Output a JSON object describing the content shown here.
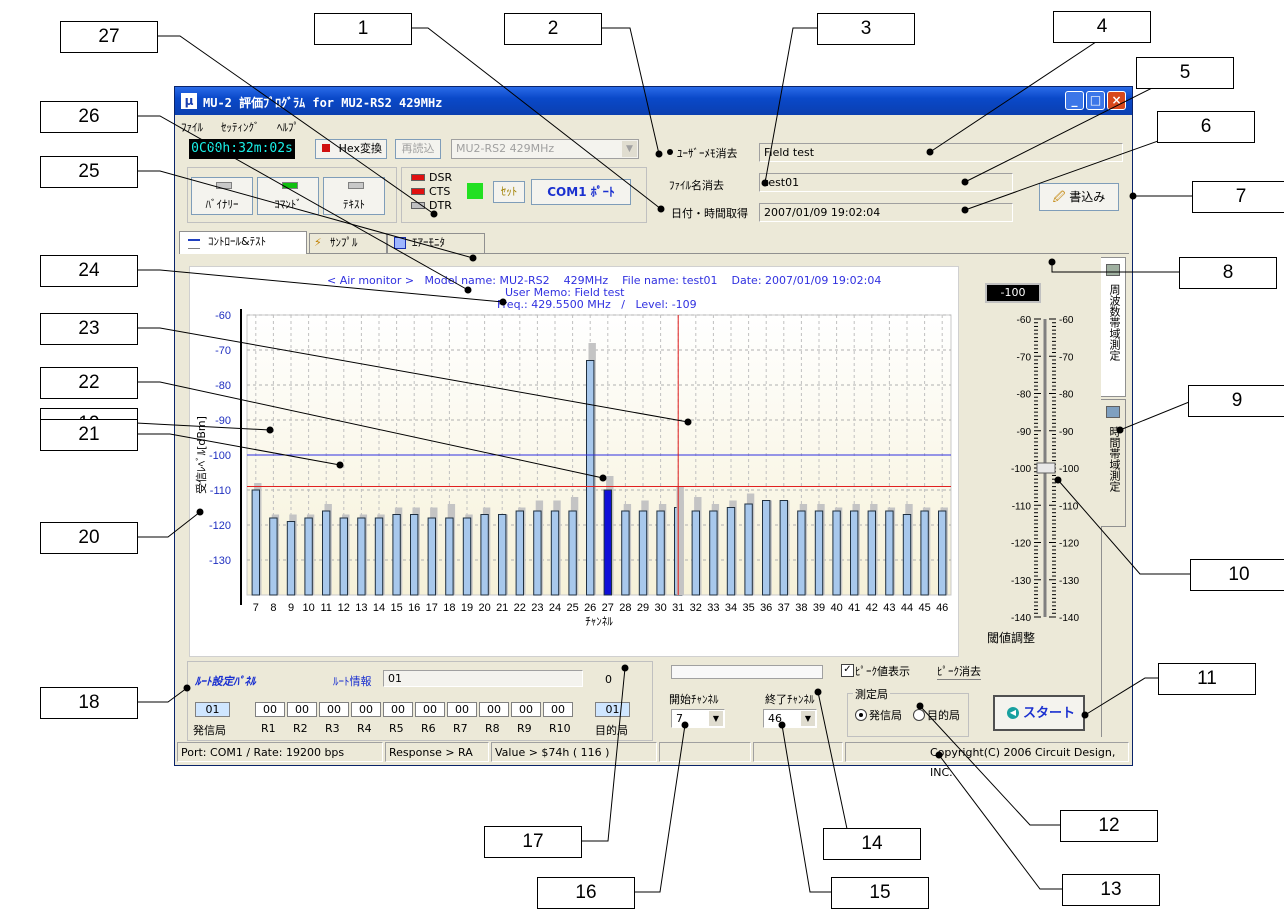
{
  "window": {
    "title": "MU-2 評価ﾌﾟﾛｸﾞﾗﾑ for MU2-RS2    429MHz",
    "icon_letter": "μ"
  },
  "menu": [
    "ﾌｧｲﾙ",
    "ｾｯﾃｨﾝｸﾞ",
    "ﾍﾙﾌﾟ"
  ],
  "toolbar": {
    "timer": "0C00h:32m:02s",
    "hex_button": "Hex変換",
    "reload_button": "再読込",
    "model_select": "MU2-RS2    429MHz",
    "mode_binary": "ﾊﾞｲﾅﾘｰ",
    "mode_command": "ｺﾏﾝﾄﾞ",
    "mode_text": "ﾃｷｽﾄ",
    "dsr": "DSR",
    "cts": "CTS",
    "dtr": "DTR",
    "set_button": "ｾｯﾄ",
    "com_button": "COM1 ﾎﾟｰﾄ"
  },
  "memo": {
    "user_memo_clear": "ﾕｰｻﾞｰﾒﾓ消去",
    "user_memo_value": "Field test",
    "filename_clear": "ﾌｧｲﾙ名消去",
    "filename_value": "test01",
    "datetime_get": "日付・時間取得",
    "datetime_value": "2007/01/09 19:02:04",
    "write_button": "書込み"
  },
  "tabs": [
    "ｺﾝﾄﾛｰﾙ&ﾃｽﾄ",
    "ｻﾝﾌﾟﾙ",
    "ｴｱｰﾓﾆﾀ"
  ],
  "plot_header": {
    "line1": "< Air monitor >   Model name: MU2-RS2    429MHz    File name: test01    Date: 2007/01/09 19:02:04",
    "line2": "User Memo: Field test",
    "line3": "Freq.: 429.5500 MHz   /   Level: -109"
  },
  "chart_data": {
    "type": "bar",
    "ylabel": "受信ﾚﾍﾞﾙ[dBm]",
    "xlabel": "ﾁｬﾝﾈﾙ",
    "ylim": [
      -140,
      -60
    ],
    "y_ticks": [
      -60,
      -70,
      -80,
      -90,
      -100,
      -110,
      -120,
      -130
    ],
    "categories": [
      "7",
      "8",
      "9",
      "10",
      "11",
      "12",
      "13",
      "14",
      "15",
      "16",
      "17",
      "18",
      "19",
      "20",
      "21",
      "22",
      "23",
      "24",
      "25",
      "26",
      "27",
      "28",
      "29",
      "30",
      "31",
      "32",
      "33",
      "34",
      "35",
      "36",
      "37",
      "38",
      "39",
      "40",
      "41",
      "42",
      "43",
      "44",
      "45",
      "46"
    ],
    "series": [
      {
        "values": [
          -110,
          -118,
          -119,
          -118,
          -116,
          -118,
          -118,
          -118,
          -117,
          -117,
          -118,
          -118,
          -118,
          -117,
          -117,
          -116,
          -116,
          -116,
          -116,
          -73,
          -110,
          -116,
          -116,
          -116,
          -115,
          -116,
          -116,
          -115,
          -114,
          -113,
          -113,
          -116,
          -116,
          -116,
          -116,
          -116,
          -116,
          -117,
          -116,
          -116
        ]
      },
      {
        "values": [
          -108,
          -117,
          -117,
          -117,
          -114,
          -117,
          -117,
          -117,
          -115,
          -115,
          -115,
          -114,
          -117,
          -115,
          -117,
          -115,
          -113,
          -113,
          -112,
          -68,
          -106,
          -114,
          -113,
          -114,
          -113,
          -112,
          -114,
          -113,
          -111,
          -113,
          -113,
          -114,
          -114,
          -115,
          -114,
          -114,
          -115,
          -114,
          -115,
          -115
        ]
      }
    ],
    "peak_extra": {
      "channel": "31",
      "value": -109
    },
    "threshold_line": -100,
    "level_line": -109,
    "selected_channel": "27",
    "cursor_channel": "31"
  },
  "threshold": {
    "value_display": "-100",
    "scale": [
      "-60",
      "-70",
      "-80",
      "-90",
      "-100",
      "-110",
      "-120",
      "-130",
      "-140"
    ],
    "label": "閾値調整",
    "slider_value": -100
  },
  "side_tabs": [
    "周波数帯域測定",
    "時間帯域測定"
  ],
  "route": {
    "panel_title": "ﾙｰﾄ設定ﾊﾟﾈﾙ",
    "info_label": "ﾙｰﾄ情報",
    "info_value": "01",
    "count": "0",
    "source_value": "01",
    "source_label": "発信局",
    "relays": [
      "00",
      "00",
      "00",
      "00",
      "00",
      "00",
      "00",
      "00",
      "00",
      "00"
    ],
    "relay_labels": [
      "R1",
      "R2",
      "R3",
      "R4",
      "R5",
      "R6",
      "R7",
      "R8",
      "R9",
      "R10"
    ],
    "dest_value": "01",
    "dest_label": "目的局"
  },
  "scan": {
    "peak_display": "ﾋﾟｰｸ値表示",
    "peak_clear": "ﾋﾟｰｸ消去",
    "start_ch_label": "開始ﾁｬﾝﾈﾙ",
    "start_ch": "7",
    "end_ch_label": "終了ﾁｬﾝﾈﾙ",
    "end_ch": "46",
    "station_label": "測定局",
    "station_src": "発信局",
    "station_dst": "目的局",
    "start_button": "スタート"
  },
  "statusbar": {
    "port": "Port: COM1  /  Rate: 19200 bps",
    "response": "Response > RA",
    "value": "Value > $74h ( 116 )",
    "copyright": "Copyright(C) 2006 Circuit Design, INC."
  },
  "callouts": [
    "1",
    "2",
    "3",
    "4",
    "5",
    "6",
    "7",
    "8",
    "9",
    "10",
    "11",
    "12",
    "13",
    "14",
    "15",
    "16",
    "17",
    "18",
    "19",
    "20",
    "21",
    "22",
    "23",
    "24",
    "25",
    "26",
    "27"
  ]
}
